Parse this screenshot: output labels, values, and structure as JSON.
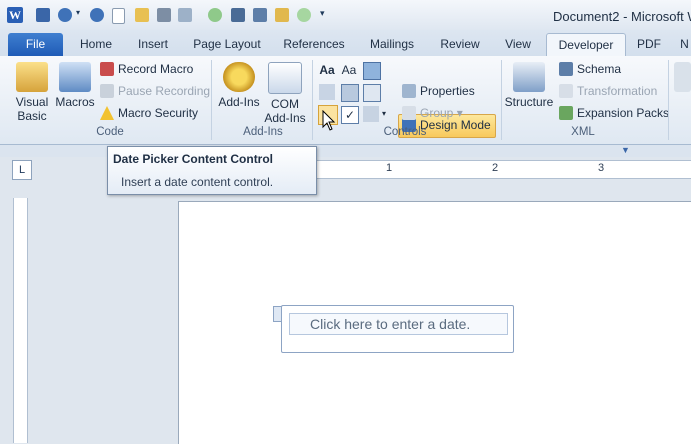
{
  "window": {
    "title": "Document2 - Microsoft W"
  },
  "tabs": [
    {
      "label": "File"
    },
    {
      "label": "Home"
    },
    {
      "label": "Insert"
    },
    {
      "label": "Page Layout"
    },
    {
      "label": "References"
    },
    {
      "label": "Mailings"
    },
    {
      "label": "Review"
    },
    {
      "label": "View"
    },
    {
      "label": "Developer"
    },
    {
      "label": "PDF"
    },
    {
      "label": "N"
    }
  ],
  "ribbon": {
    "code": {
      "label": "Code",
      "visual_basic": "Visual\nBasic",
      "macros": "Macros",
      "record_macro": "Record Macro",
      "pause_recording": "Pause Recording",
      "macro_security": "Macro Security"
    },
    "addins": {
      "label": "Add-Ins",
      "addins_button": "Add-Ins",
      "com_addins_line1": "COM",
      "com_addins_line2": "Add-Ins"
    },
    "controls": {
      "label": "Controls",
      "design_mode": "Design Mode",
      "properties": "Properties",
      "group": "Group"
    },
    "xml": {
      "label": "XML",
      "structure": "Structure",
      "schema": "Schema",
      "transformation": "Transformation",
      "expansion_packs": "Expansion Packs"
    }
  },
  "tooltip": {
    "title": "Date Picker Content Control",
    "description": "Insert a date content control."
  },
  "ruler": {
    "marks": [
      "1",
      "2",
      "3"
    ]
  },
  "document": {
    "date_placeholder": "Click here to enter a date."
  },
  "colors": {
    "file_tab": "#2a64bd",
    "design_mode_bg": "#f9d778",
    "accent": "#2a5fb5"
  }
}
